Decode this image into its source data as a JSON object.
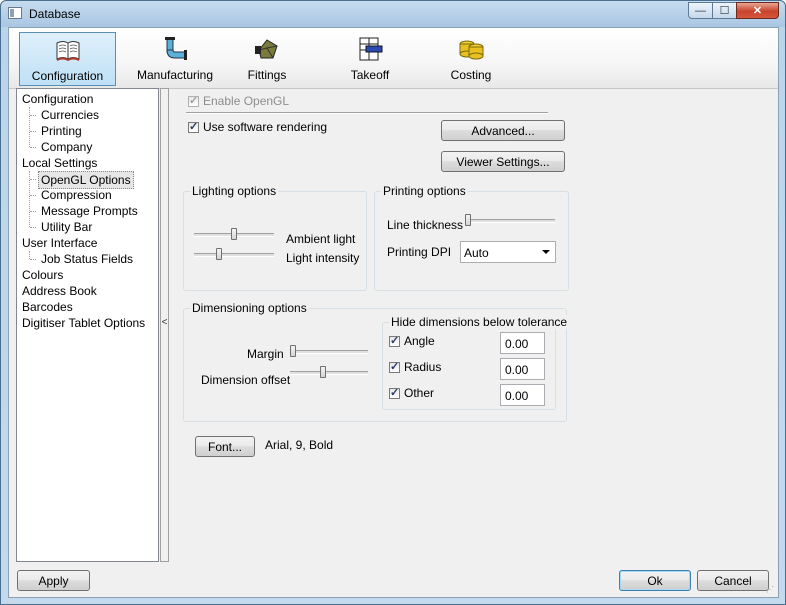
{
  "window": {
    "title": "Database"
  },
  "toolbar": {
    "tabs": [
      {
        "label": "Configuration",
        "icon": "book-icon",
        "selected": true
      },
      {
        "label": "Manufacturing",
        "icon": "pipe-bend-icon"
      },
      {
        "label": "Fittings",
        "icon": "fitting-icon"
      },
      {
        "label": "Takeoff",
        "icon": "takeoff-sheet-icon"
      },
      {
        "label": "Costing",
        "icon": "coins-icon"
      }
    ]
  },
  "tree": {
    "items": [
      {
        "label": "Configuration"
      },
      {
        "label": "Currencies"
      },
      {
        "label": "Printing"
      },
      {
        "label": "Company"
      },
      {
        "label": "Local Settings"
      },
      {
        "label": "OpenGL Options"
      },
      {
        "label": "Compression"
      },
      {
        "label": "Message Prompts"
      },
      {
        "label": "Utility Bar"
      },
      {
        "label": "User Interface"
      },
      {
        "label": "Job Status Fields"
      },
      {
        "label": "Colours"
      },
      {
        "label": "Address Book"
      },
      {
        "label": "Barcodes"
      },
      {
        "label": "Digitiser Tablet Options"
      }
    ],
    "selected": "OpenGL Options"
  },
  "splitter": {
    "glyph": "<"
  },
  "opengl": {
    "enable_opengl": {
      "label": "Enable OpenGL",
      "checked": true,
      "enabled": false
    },
    "use_software_rendering": {
      "label": "Use software rendering",
      "checked": true
    },
    "advanced_button": "Advanced...",
    "viewer_settings_button": "Viewer Settings..."
  },
  "lighting": {
    "title": "Lighting options",
    "ambient_label": "Ambient light",
    "ambient_value": 0.5,
    "intensity_label": "Light intensity",
    "intensity_value": 0.3
  },
  "printing": {
    "title": "Printing options",
    "line_thickness_label": "Line thickness",
    "line_thickness_value": 0.0,
    "dpi_label": "Printing DPI",
    "dpi_value": "Auto"
  },
  "dimensioning": {
    "title": "Dimensioning options",
    "margin_label": "Margin",
    "margin_value": 0.0,
    "offset_label": "Dimension offset",
    "offset_value": 0.45,
    "hide_title": "Hide dimensions below tolerance",
    "angle": {
      "label": "Angle",
      "checked": true,
      "value": "0.00"
    },
    "radius": {
      "label": "Radius",
      "checked": true,
      "value": "0.00"
    },
    "other": {
      "label": "Other",
      "checked": true,
      "value": "0.00"
    }
  },
  "font": {
    "button": "Font...",
    "value": "Arial, 9, Bold"
  },
  "footer": {
    "apply": "Apply",
    "ok": "Ok",
    "cancel": "Cancel"
  },
  "window_buttons": {
    "minimize": "—",
    "maximize": "☐",
    "close": "✕"
  }
}
